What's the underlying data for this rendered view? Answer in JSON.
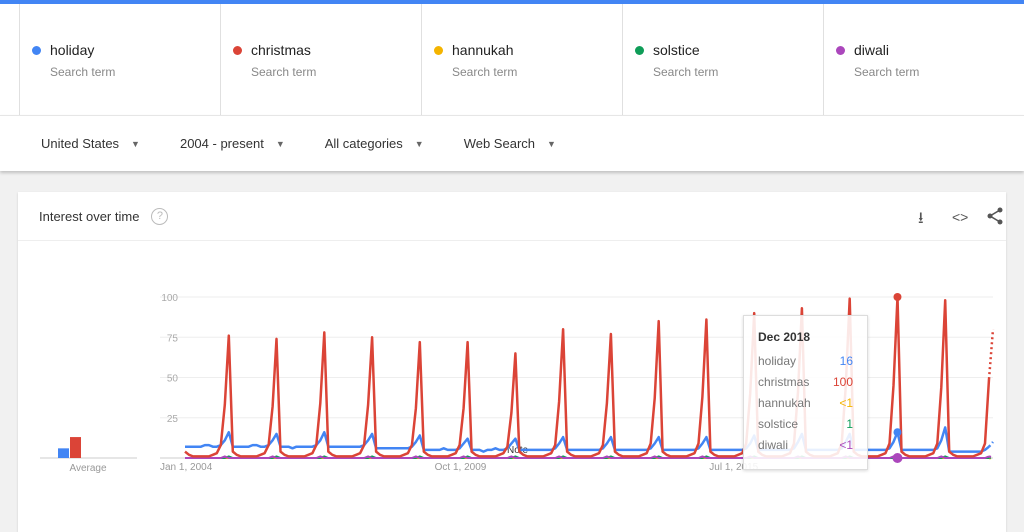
{
  "terms": [
    {
      "name": "holiday",
      "sub": "Search term",
      "color": "#4285f4"
    },
    {
      "name": "christmas",
      "sub": "Search term",
      "color": "#db4437"
    },
    {
      "name": "hannukah",
      "sub": "Search term",
      "color": "#f4b400"
    },
    {
      "name": "solstice",
      "sub": "Search term",
      "color": "#0f9d58"
    },
    {
      "name": "diwali",
      "sub": "Search term",
      "color": "#ab47bc"
    }
  ],
  "filters": [
    "United States",
    "2004 - present",
    "All categories",
    "Web Search"
  ],
  "card": {
    "title": "Interest over time",
    "help_icon": "question-circle-icon",
    "icons": [
      "download-icon",
      "embed-code-icon",
      "share-icon"
    ]
  },
  "tooltip": {
    "date": "Dec 2018",
    "rows": [
      {
        "name": "holiday",
        "value": "16",
        "color": "#4285f4"
      },
      {
        "name": "christmas",
        "value": "100",
        "color": "#db4437"
      },
      {
        "name": "hannukah",
        "value": "<1",
        "color": "#f4b400"
      },
      {
        "name": "solstice",
        "value": "1",
        "color": "#0f9d58"
      },
      {
        "name": "diwali",
        "value": "<1",
        "color": "#ab47bc"
      }
    ]
  },
  "chart_data": {
    "type": "line",
    "x_start": "Jan 2004",
    "x_step": "month",
    "xticks": [
      "Jan 1, 2004",
      "Oct 1, 2009",
      "Jul 1, 2015"
    ],
    "yticks": [
      25,
      50,
      75,
      100
    ],
    "ylim": [
      0,
      100
    ],
    "grid": true,
    "note_label": "Note",
    "average": {
      "label": "Average",
      "values": {
        "holiday": 6,
        "christmas": 13,
        "hannukah": 0,
        "solstice": 0,
        "diwali": 0
      }
    },
    "partial_last_point": true,
    "series": [
      {
        "name": "holiday",
        "color": "#4285f4",
        "by_year": [
          [
            7,
            7,
            7,
            7,
            7,
            8,
            8,
            7,
            7,
            8,
            11,
            16
          ],
          [
            7,
            7,
            7,
            7,
            7,
            8,
            8,
            7,
            7,
            8,
            11,
            15
          ],
          [
            7,
            7,
            7,
            6,
            7,
            7,
            7,
            7,
            7,
            8,
            11,
            16
          ],
          [
            7,
            7,
            7,
            7,
            7,
            7,
            7,
            7,
            7,
            8,
            11,
            15
          ],
          [
            6,
            6,
            6,
            6,
            6,
            6,
            6,
            6,
            6,
            7,
            10,
            14
          ],
          [
            5,
            5,
            5,
            5,
            5,
            6,
            5,
            5,
            5,
            6,
            9,
            12
          ],
          [
            5,
            5,
            5,
            4,
            5,
            5,
            6,
            5,
            5,
            6,
            9,
            12
          ],
          [
            5,
            5,
            5,
            5,
            5,
            5,
            5,
            5,
            5,
            6,
            9,
            13
          ],
          [
            5,
            5,
            5,
            5,
            5,
            5,
            5,
            5,
            5,
            6,
            9,
            13
          ],
          [
            5,
            5,
            5,
            5,
            5,
            5,
            5,
            5,
            5,
            6,
            9,
            13
          ],
          [
            5,
            5,
            5,
            5,
            5,
            5,
            5,
            5,
            5,
            6,
            9,
            13
          ],
          [
            5,
            5,
            5,
            5,
            5,
            5,
            5,
            5,
            5,
            6,
            9,
            14
          ],
          [
            5,
            5,
            5,
            5,
            5,
            5,
            5,
            5,
            5,
            6,
            10,
            15
          ],
          [
            5,
            5,
            5,
            5,
            5,
            5,
            5,
            5,
            5,
            6,
            10,
            15
          ],
          [
            5,
            5,
            5,
            5,
            5,
            5,
            5,
            5,
            5,
            6,
            10,
            16
          ],
          [
            5,
            5,
            5,
            5,
            5,
            5,
            5,
            5,
            5,
            6,
            11,
            19
          ],
          [
            4,
            4,
            4,
            4,
            4,
            4,
            4,
            4,
            4,
            5,
            7,
            10
          ]
        ]
      },
      {
        "name": "christmas",
        "color": "#db4437",
        "by_year": [
          [
            4,
            2,
            1,
            1,
            1,
            1,
            1,
            2,
            3,
            8,
            33,
            76
          ],
          [
            4,
            2,
            1,
            1,
            1,
            1,
            1,
            2,
            3,
            8,
            32,
            74
          ],
          [
            4,
            2,
            1,
            1,
            1,
            1,
            1,
            2,
            3,
            8,
            34,
            78
          ],
          [
            4,
            2,
            1,
            1,
            1,
            1,
            1,
            2,
            3,
            8,
            33,
            75
          ],
          [
            4,
            2,
            1,
            1,
            1,
            1,
            1,
            2,
            3,
            8,
            31,
            72
          ],
          [
            4,
            2,
            1,
            1,
            1,
            1,
            1,
            2,
            3,
            8,
            31,
            72
          ],
          [
            4,
            2,
            1,
            1,
            1,
            1,
            1,
            2,
            3,
            7,
            28,
            65
          ],
          [
            4,
            2,
            1,
            1,
            1,
            1,
            1,
            2,
            3,
            8,
            35,
            80
          ],
          [
            4,
            2,
            1,
            1,
            1,
            1,
            1,
            2,
            3,
            8,
            34,
            77
          ],
          [
            4,
            2,
            1,
            1,
            1,
            1,
            1,
            2,
            3,
            9,
            37,
            85
          ],
          [
            4,
            2,
            1,
            1,
            1,
            1,
            1,
            2,
            3,
            9,
            38,
            86
          ],
          [
            4,
            2,
            1,
            1,
            1,
            1,
            1,
            2,
            3,
            9,
            40,
            90
          ],
          [
            4,
            2,
            1,
            1,
            1,
            1,
            1,
            2,
            3,
            9,
            41,
            93
          ],
          [
            4,
            2,
            1,
            1,
            1,
            1,
            1,
            2,
            3,
            9,
            44,
            99
          ],
          [
            4,
            2,
            1,
            1,
            1,
            1,
            1,
            2,
            3,
            9,
            45,
            100
          ],
          [
            4,
            2,
            1,
            1,
            1,
            1,
            1,
            2,
            3,
            9,
            44,
            98
          ],
          [
            4,
            2,
            1,
            1,
            1,
            1,
            1,
            2,
            3,
            9,
            49,
            80
          ]
        ]
      },
      {
        "name": "hannukah",
        "color": "#f4b400",
        "by_year": "0 every month"
      },
      {
        "name": "solstice",
        "color": "#0f9d58",
        "by_year": "0-1, 1 each December"
      },
      {
        "name": "diwali",
        "color": "#ab47bc",
        "by_year": "0-1, 1 each October/November"
      }
    ]
  }
}
